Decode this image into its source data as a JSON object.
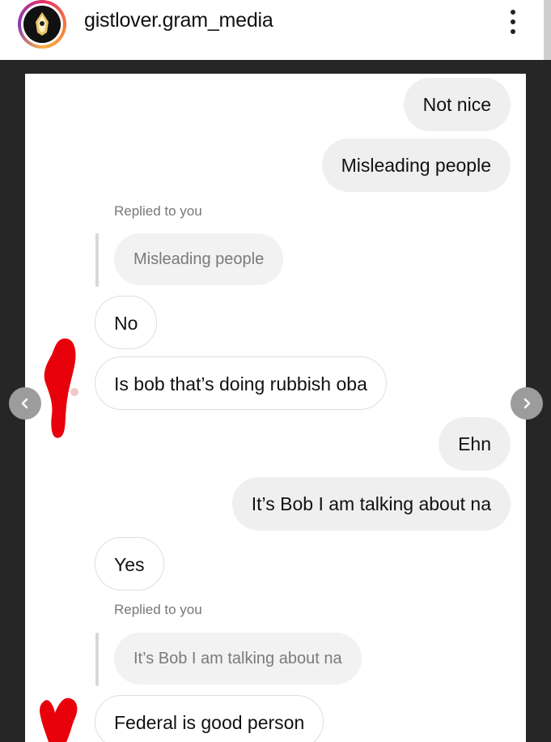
{
  "header": {
    "username": "gistlover.gram_media",
    "avatar_icon": "profile-avatar",
    "more_icon": "more-vertical-icon"
  },
  "colors": {
    "sent_bubble": "#efefef",
    "received_border": "#dedede",
    "frame": "#262626",
    "redaction": "#e8000b"
  },
  "messages": [
    {
      "type": "sent",
      "text": "Not nice"
    },
    {
      "type": "sent",
      "text": "Misleading people"
    },
    {
      "type": "reply_label",
      "text": "Replied to you"
    },
    {
      "type": "quote",
      "text": "Misleading people"
    },
    {
      "type": "received",
      "text": "No"
    },
    {
      "type": "received",
      "text": "Is bob that’s doing rubbish oba"
    },
    {
      "type": "sent",
      "text": "Ehn"
    },
    {
      "type": "sent",
      "text": "It’s Bob I am talking about na"
    },
    {
      "type": "received",
      "text": "Yes"
    },
    {
      "type": "reply_label",
      "text": "Replied to you"
    },
    {
      "type": "quote",
      "text": "It’s Bob I am talking about na"
    },
    {
      "type": "received",
      "text": "Federal is good person"
    }
  ],
  "navigation": {
    "prev_icon": "chevron-left-icon",
    "next_icon": "chevron-right-icon"
  }
}
